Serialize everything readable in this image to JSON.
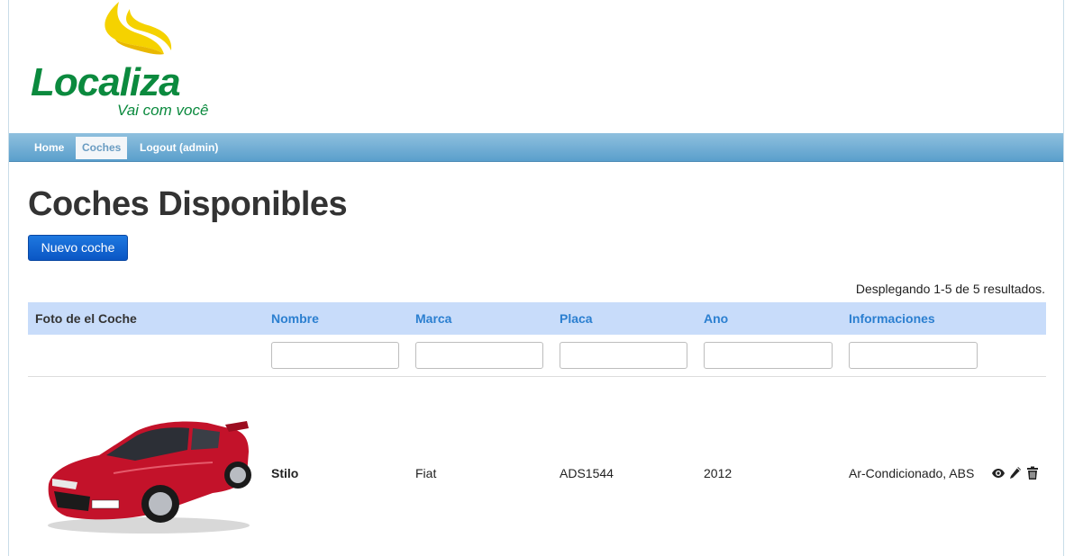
{
  "brand": {
    "name": "Localiza",
    "tagline": "Vai com você",
    "colors": {
      "green": "#0b8a3e",
      "yellow": "#f5d200"
    }
  },
  "nav": {
    "items": [
      {
        "label": "Home",
        "active": false
      },
      {
        "label": "Coches",
        "active": true
      },
      {
        "label": "Logout (admin)",
        "active": false
      }
    ]
  },
  "page": {
    "title": "Coches Disponibles",
    "new_button": "Nuevo coche",
    "summary": "Desplegando 1-5 de 5 resultados."
  },
  "table": {
    "columns": [
      {
        "label": "Foto de el Coche",
        "sortable": false
      },
      {
        "label": "Nombre",
        "sortable": true
      },
      {
        "label": "Marca",
        "sortable": true
      },
      {
        "label": "Placa",
        "sortable": true
      },
      {
        "label": "Ano",
        "sortable": true
      },
      {
        "label": "Informaciones",
        "sortable": true
      }
    ],
    "filters": [
      "",
      "",
      "",
      "",
      ""
    ],
    "rows": [
      {
        "photo": "red-sedan-photo",
        "nombre": "Stilo",
        "marca": "Fiat",
        "placa": "ADS1544",
        "ano": "2012",
        "informaciones": "Ar-Condicionado, ABS",
        "actions": [
          "eye-icon",
          "pencil-icon",
          "trash-icon"
        ]
      }
    ]
  },
  "colors": {
    "nav_bar": "#5a9fcc",
    "table_header": "#c8dcfa",
    "link": "#2b7fd0",
    "primary_button": "#0a56c4",
    "car_red": "#c3122a"
  }
}
